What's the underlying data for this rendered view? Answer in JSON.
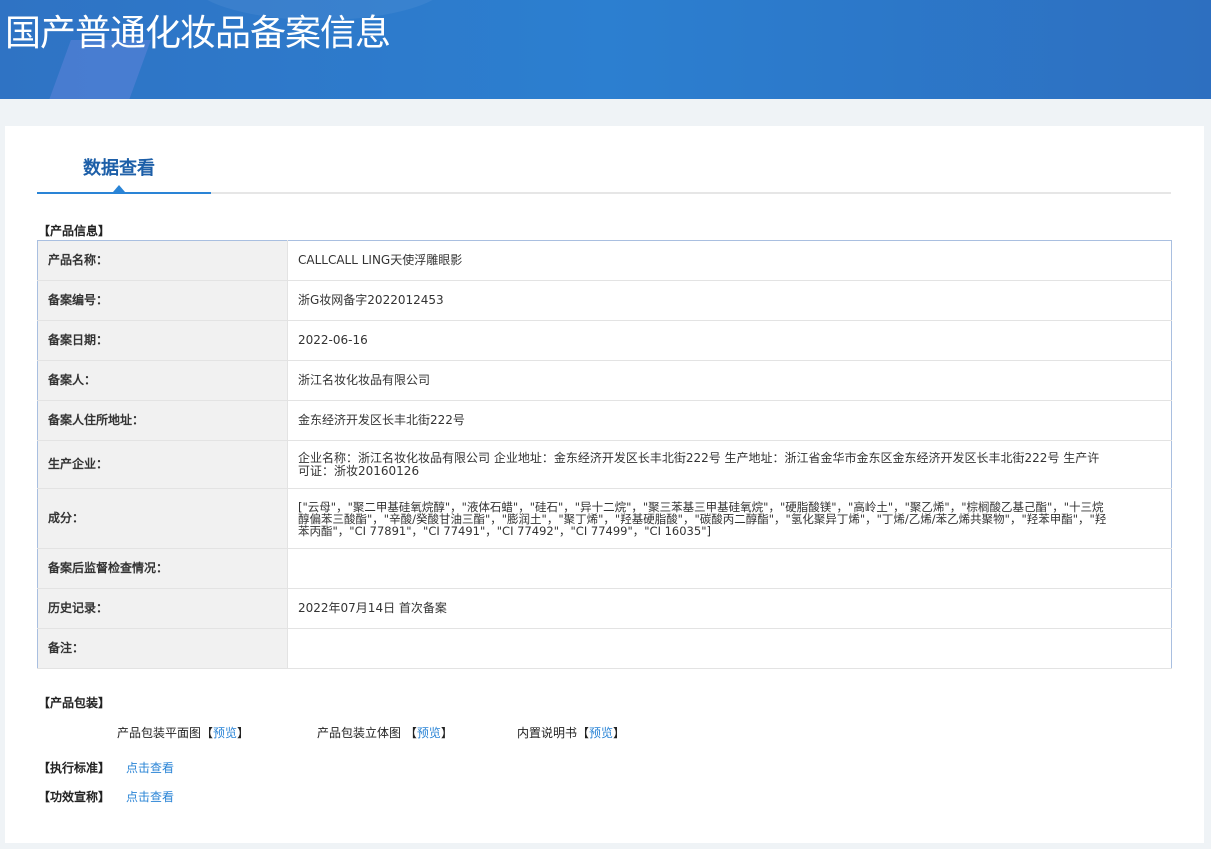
{
  "header": {
    "title": "国产普通化妆品备案信息"
  },
  "tab": {
    "label": "数据查看"
  },
  "product_section": {
    "title": "【产品信息】"
  },
  "rows": [
    {
      "label": "产品名称：",
      "value": "CALLCALL LING天使浮雕眼影"
    },
    {
      "label": "备案编号：",
      "value": "浙G妆网备字2022012453"
    },
    {
      "label": "备案日期：",
      "value": "2022-06-16"
    },
    {
      "label": "备案人：",
      "value": "浙江名妆化妆品有限公司"
    },
    {
      "label": "备案人住所地址：",
      "value": "金东经济开发区长丰北街222号"
    },
    {
      "label": "生产企业：",
      "value": "企业名称：浙江名妆化妆品有限公司 企业地址：金东经济开发区长丰北街222号 生产地址：浙江省金华市金东区金东经济开发区长丰北街222号 生产许可证：浙妆20160126"
    },
    {
      "label": "成分：",
      "value": "[\"云母\"，\"聚二甲基硅氧烷醇\"，\"液体石蜡\"，\"硅石\"，\"异十二烷\"，\"聚三苯基三甲基硅氧烷\"，\"硬脂酸镁\"，\"高岭土\"，\"聚乙烯\"，\"棕榈酸乙基己酯\"，\"十三烷醇偏苯三酸酯\"，\"辛酸/癸酸甘油三酯\"，\"膨润土\"，\"聚丁烯\"，\"羟基硬脂酸\"，\"碳酸丙二醇酯\"，\"氢化聚异丁烯\"，\"丁烯/乙烯/苯乙烯共聚物\"，\"羟苯甲酯\"，\"羟苯丙酯\"，\"CI 77891\"，\"CI 77491\"，\"CI 77492\"，\"CI 77499\"，\"CI 16035\"]"
    },
    {
      "label": "备案后监督检查情况：",
      "value": ""
    },
    {
      "label": "历史记录：",
      "value": "2022年07月14日 首次备案"
    },
    {
      "label": "备注：",
      "value": ""
    }
  ],
  "packaging": {
    "title": "【产品包装】",
    "items": [
      {
        "label": "产品包装平面图【",
        "link": "预览",
        "close": "】"
      },
      {
        "label": "产品包装立体图 【",
        "link": "预览",
        "close": "】"
      },
      {
        "label": "内置说明书【",
        "link": "预览",
        "close": "】"
      }
    ]
  },
  "standard": {
    "title": "【执行标准】",
    "link": "点击查看"
  },
  "claims": {
    "title": "【功效宣称】",
    "link": "点击查看"
  }
}
